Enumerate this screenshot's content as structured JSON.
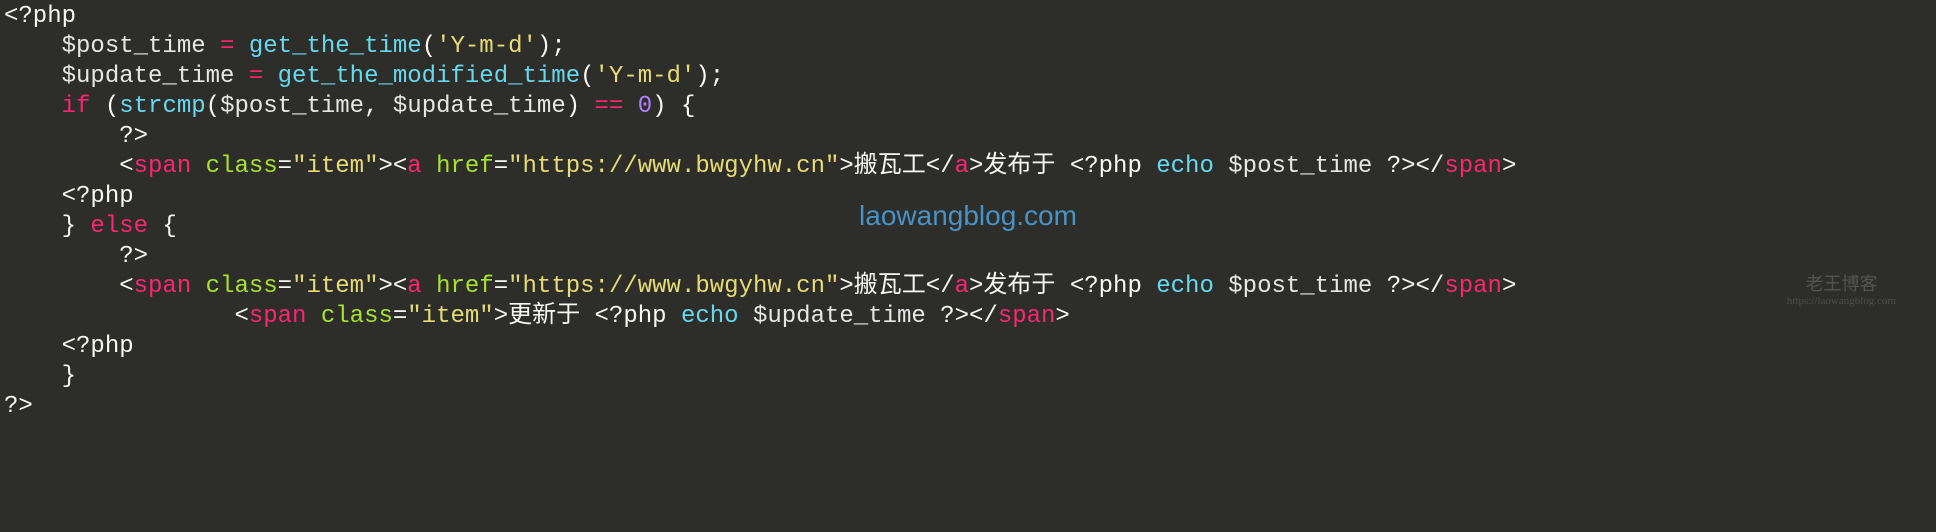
{
  "code": {
    "l1": {
      "phpopen": "<?php"
    },
    "l2": {
      "indent": "    ",
      "var1": "$post_time",
      "assign": " = ",
      "fn": "get_the_time",
      "paren_o": "(",
      "str": "'Y-m-d'",
      "paren_c": ");"
    },
    "l3": {
      "indent": "    ",
      "var1": "$update_time",
      "assign": " = ",
      "fn": "get_the_modified_time",
      "paren_o": "(",
      "str": "'Y-m-d'",
      "paren_c": ");"
    },
    "l4": {
      "indent": "    ",
      "kw": "if",
      "rest1": " (",
      "fn": "strcmp",
      "rest2": "(",
      "var1": "$post_time",
      "comma": ", ",
      "var2": "$update_time",
      "rest3": ") ",
      "op": "==",
      "sp": " ",
      "num": "0",
      "rest4": ") {"
    },
    "l5": {
      "indent": "        ",
      "txt": "?>"
    },
    "l6": {
      "indent": "        ",
      "lt1": "<",
      "tag1": "span",
      "sp1": " ",
      "attr1": "class",
      "eq1": "=",
      "val1": "\"item\"",
      "gt1": ">",
      "lt2": "<",
      "tag2": "a",
      "sp2": " ",
      "attr2": "href",
      "eq2": "=",
      "val2": "\"https://www.bwgyhw.cn\"",
      "gt2": ">",
      "linktxt": "搬瓦工",
      "lt3": "</",
      "tag3": "a",
      "gt3": ">",
      "txt2": "发布于 ",
      "phpo": "<?php ",
      "echo": "echo",
      "sp3": " ",
      "var": "$post_time",
      "phpc": " ?>",
      "lt4": "</",
      "tag4": "span",
      "gt4": ">"
    },
    "l7": {
      "indent": "    ",
      "txt": "<?php"
    },
    "l8": {
      "indent": "    ",
      "brace": "} ",
      "kw": "else",
      "rest": " {"
    },
    "l9": {
      "indent": "        ",
      "txt": "?>"
    },
    "l10": {
      "indent": "        ",
      "lt1": "<",
      "tag1": "span",
      "sp1": " ",
      "attr1": "class",
      "eq1": "=",
      "val1": "\"item\"",
      "gt1": ">",
      "lt2": "<",
      "tag2": "a",
      "sp2": " ",
      "attr2": "href",
      "eq2": "=",
      "val2": "\"https://www.bwgyhw.cn\"",
      "gt2": ">",
      "linktxt": "搬瓦工",
      "lt3": "</",
      "tag3": "a",
      "gt3": ">",
      "txt2": "发布于 ",
      "phpo": "<?php ",
      "echo": "echo",
      "sp3": " ",
      "var": "$post_time",
      "phpc": " ?>",
      "lt4": "</",
      "tag4": "span",
      "gt4": ">"
    },
    "l11": {
      "indent": "                ",
      "lt1": "<",
      "tag1": "span",
      "sp1": " ",
      "attr1": "class",
      "eq1": "=",
      "val1": "\"item\"",
      "gt1": ">",
      "txt2": "更新于 ",
      "phpo": "<?php ",
      "echo": "echo",
      "sp3": " ",
      "var": "$update_time",
      "phpc": " ?>",
      "lt4": "</",
      "tag4": "span",
      "gt4": ">"
    },
    "l12": {
      "indent": "    ",
      "txt": "<?php"
    },
    "l13": {
      "indent": "    ",
      "txt": "}"
    },
    "l14": {
      "txt": "?>"
    }
  },
  "watermark": {
    "center": "laowangblog.com",
    "corner_main": "老王博客",
    "corner_sub": "https://laowangblog.com"
  }
}
